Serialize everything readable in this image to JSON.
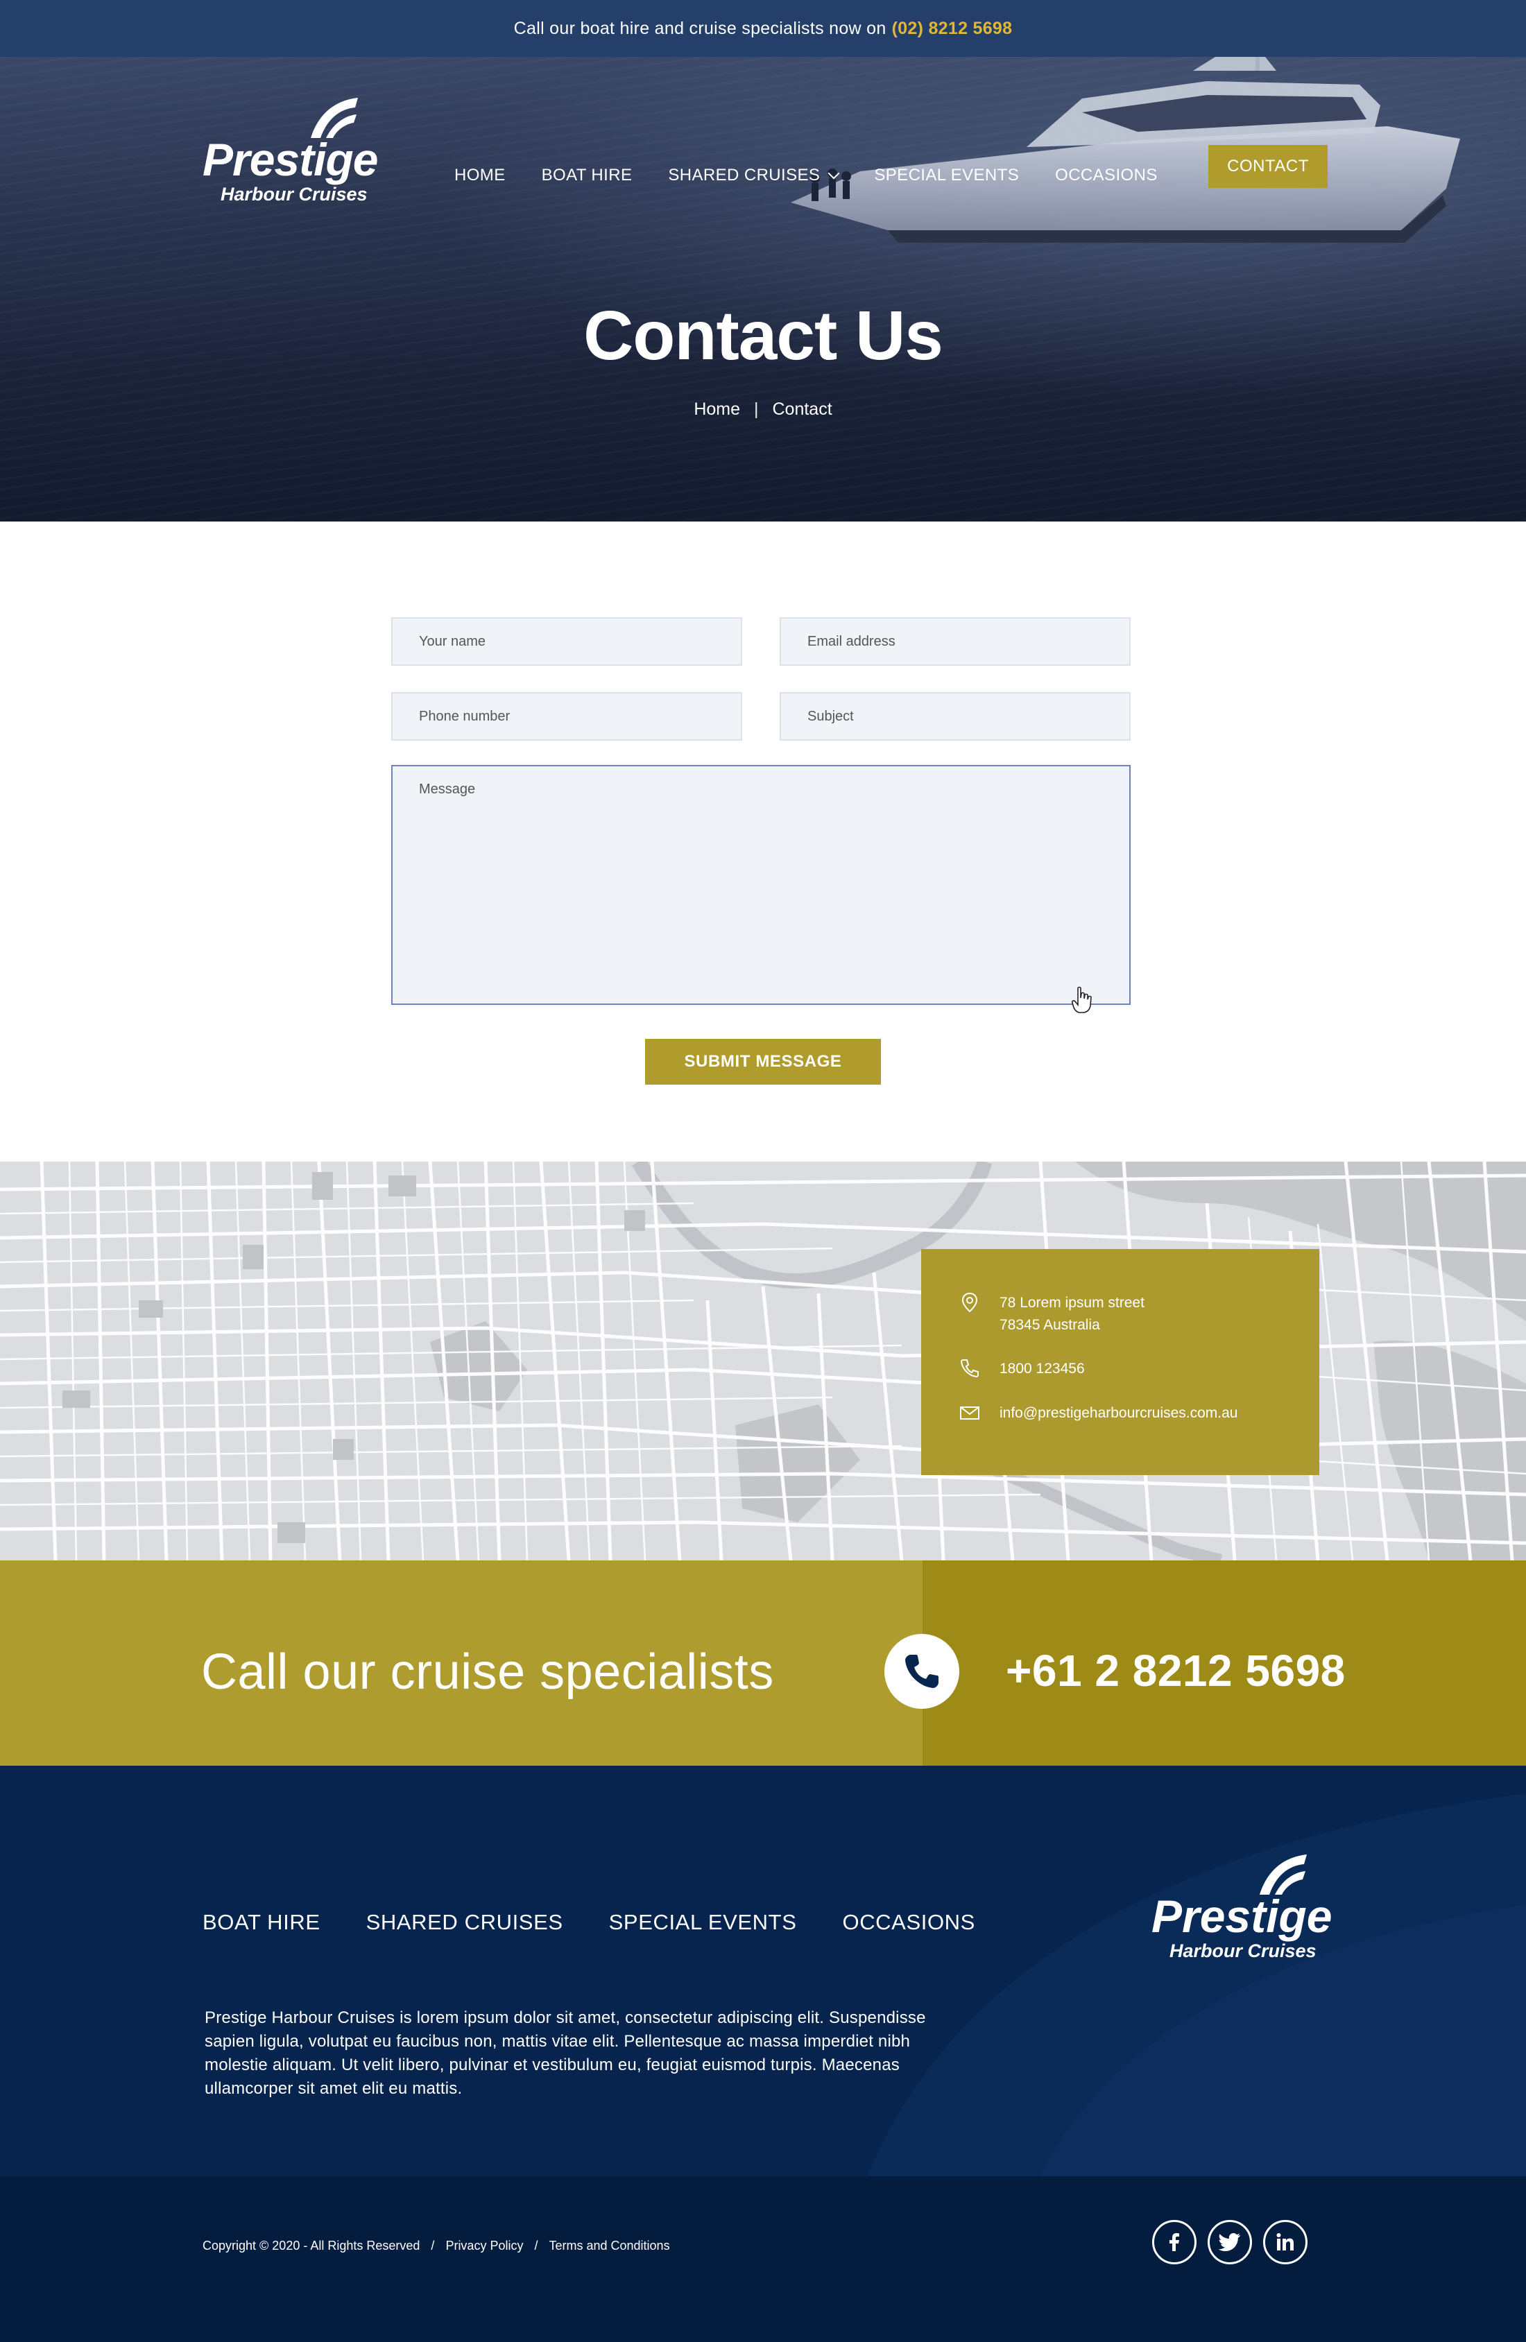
{
  "topbar": {
    "text": "Call our boat hire and cruise specialists now on",
    "phone": "(02) 8212 5698"
  },
  "brand": {
    "name": "Prestige",
    "tagline": "Harbour Cruises"
  },
  "nav": {
    "items": [
      {
        "label": "HOME"
      },
      {
        "label": "BOAT HIRE"
      },
      {
        "label": "SHARED CRUISES",
        "has_dropdown": true
      },
      {
        "label": "SPECIAL EVENTS"
      },
      {
        "label": "OCCASIONS"
      }
    ],
    "contact": "CONTACT"
  },
  "hero": {
    "title": "Contact Us",
    "breadcrumb": {
      "home": "Home",
      "separator": "|",
      "current": "Contact"
    }
  },
  "form": {
    "name_placeholder": "Your name",
    "email_placeholder": "Email address",
    "phone_placeholder": "Phone number",
    "subject_placeholder": "Subject",
    "message_placeholder": "Message",
    "submit": "SUBMIT MESSAGE"
  },
  "contact_info": {
    "address_line1": "78 Lorem ipsum street",
    "address_line2": "78345 Australia",
    "phone": "1800 123456",
    "email": "info@prestigeharbourcruises.com.au"
  },
  "callband": {
    "title": "Call our cruise specialists",
    "number": "+61 2 8212 5698"
  },
  "footer": {
    "nav": [
      "BOAT HIRE",
      "SHARED CRUISES",
      "SPECIAL EVENTS",
      "OCCASIONS"
    ],
    "description": "Prestige Harbour Cruises is lorem ipsum dolor sit amet, consectetur adipiscing elit. Suspendisse sapien ligula, volutpat eu faucibus non, mattis vitae elit. Pellentesque ac massa imperdiet nibh molestie aliquam. Ut velit libero, pulvinar et vestibulum eu, feugiat euismod turpis. Maecenas ullamcorper sit amet elit eu mattis.",
    "copyright": "Copyright © 2020 - All Rights Reserved",
    "separator": "/",
    "privacy": "Privacy Policy",
    "terms": "Terms and Conditions",
    "social": [
      "facebook-icon",
      "twitter-icon",
      "linkedin-icon"
    ]
  },
  "colors": {
    "navy": "#233f6a",
    "gold": "#b09b2d",
    "gold_dark": "#9e8a16",
    "footer_navy": "#06244d",
    "phone_highlight": "#e0b63a"
  }
}
